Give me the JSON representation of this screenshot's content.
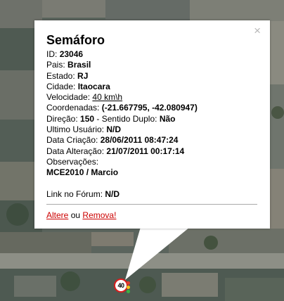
{
  "popup": {
    "close_glyph": "×",
    "title": "Semáforo",
    "id_label": "ID:",
    "id_value": "23046",
    "pais_label": "Pais:",
    "pais_value": "Brasil",
    "estado_label": "Estado:",
    "estado_value": "RJ",
    "cidade_label": "Cidade:",
    "cidade_value": "Itaocara",
    "velocidade_label": "Velocidade:",
    "velocidade_value": "40 km\\h",
    "coordenadas_label": "Coordenadas:",
    "coordenadas_value": "(-21.667795, -42.080947)",
    "direcao_label": "Direção:",
    "direcao_value": "150",
    "sentido_label": "- Sentido Duplo:",
    "sentido_value": "Não",
    "ultimo_label": "Ultimo Usuário:",
    "ultimo_value": "N/D",
    "criacao_label": "Data Criação:",
    "criacao_value": "28/06/2011 08:47:24",
    "alteracao_label": "Data Alteração:",
    "alteracao_value": "21/07/2011 00:17:14",
    "observacoes_label": "Observações:",
    "observacoes_value": "MCE2010 / Marcio",
    "forum_label": "Link no Fórum:",
    "forum_value": "N/D",
    "altere_link": "Altere",
    "ou_text": "ou",
    "remova_link": "Remova!"
  },
  "marker": {
    "speed_text": "40",
    "icon": "speed-limit-sign-icon"
  },
  "colors": {
    "link_red": "#cc0000",
    "sign_border": "#d81c1c"
  }
}
